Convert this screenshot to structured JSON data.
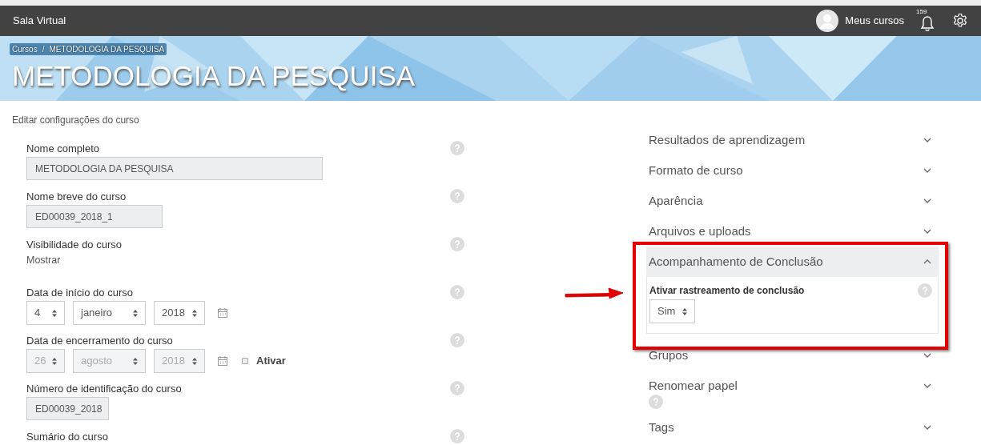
{
  "navbar": {
    "brand": "Sala Virtual",
    "user_menu": "Meus cursos",
    "notification_count": "159"
  },
  "header": {
    "breadcrumb": [
      "Cursos",
      "METODOLOGIA DA PESQUISA"
    ],
    "separator": "/",
    "title": "METODOLOGIA DA PESQUISA"
  },
  "page_heading": "Editar configurações do curso",
  "fields": [
    {
      "kind": "text",
      "label": "Nome completo",
      "value": "METODOLOGIA DA PESQUISA"
    },
    {
      "kind": "text",
      "label": "Nome breve do curso",
      "value": "ED00039_2018_1"
    },
    {
      "kind": "static",
      "label": "Visibilidade do curso",
      "value": "Mostrar"
    },
    {
      "kind": "date",
      "label": "Data de início do curso",
      "disabled": false,
      "day": "4",
      "month": "janeiro",
      "year": "2018"
    },
    {
      "kind": "date",
      "label": "Data de encerramento do curso",
      "disabled": true,
      "day": "26",
      "month": "agosto",
      "year": "2018",
      "enable": {
        "label": "Ativar",
        "checked": false
      }
    },
    {
      "kind": "text",
      "label": "Número de identificação do curso",
      "value": "ED00039_2018"
    },
    {
      "kind": "heading",
      "label": "Sumário do curso"
    }
  ],
  "sections": [
    {
      "title": "Resultados de aprendizagem",
      "expanded": false,
      "help": false
    },
    {
      "title": "Formato de curso",
      "expanded": false,
      "help": false
    },
    {
      "title": "Aparência",
      "expanded": false,
      "help": false
    },
    {
      "title": "Arquivos e uploads",
      "expanded": false,
      "help": false
    },
    {
      "title": "Acompanhamento de Conclusão",
      "expanded": true,
      "help": false,
      "field": {
        "label": "Ativar rastreamento de conclusão",
        "value": "Sim"
      }
    },
    {
      "title": "Grupos",
      "expanded": false,
      "help": false
    },
    {
      "title": "Renomear papel",
      "expanded": false,
      "help": true
    },
    {
      "title": "Tags",
      "expanded": false,
      "help": false
    }
  ]
}
